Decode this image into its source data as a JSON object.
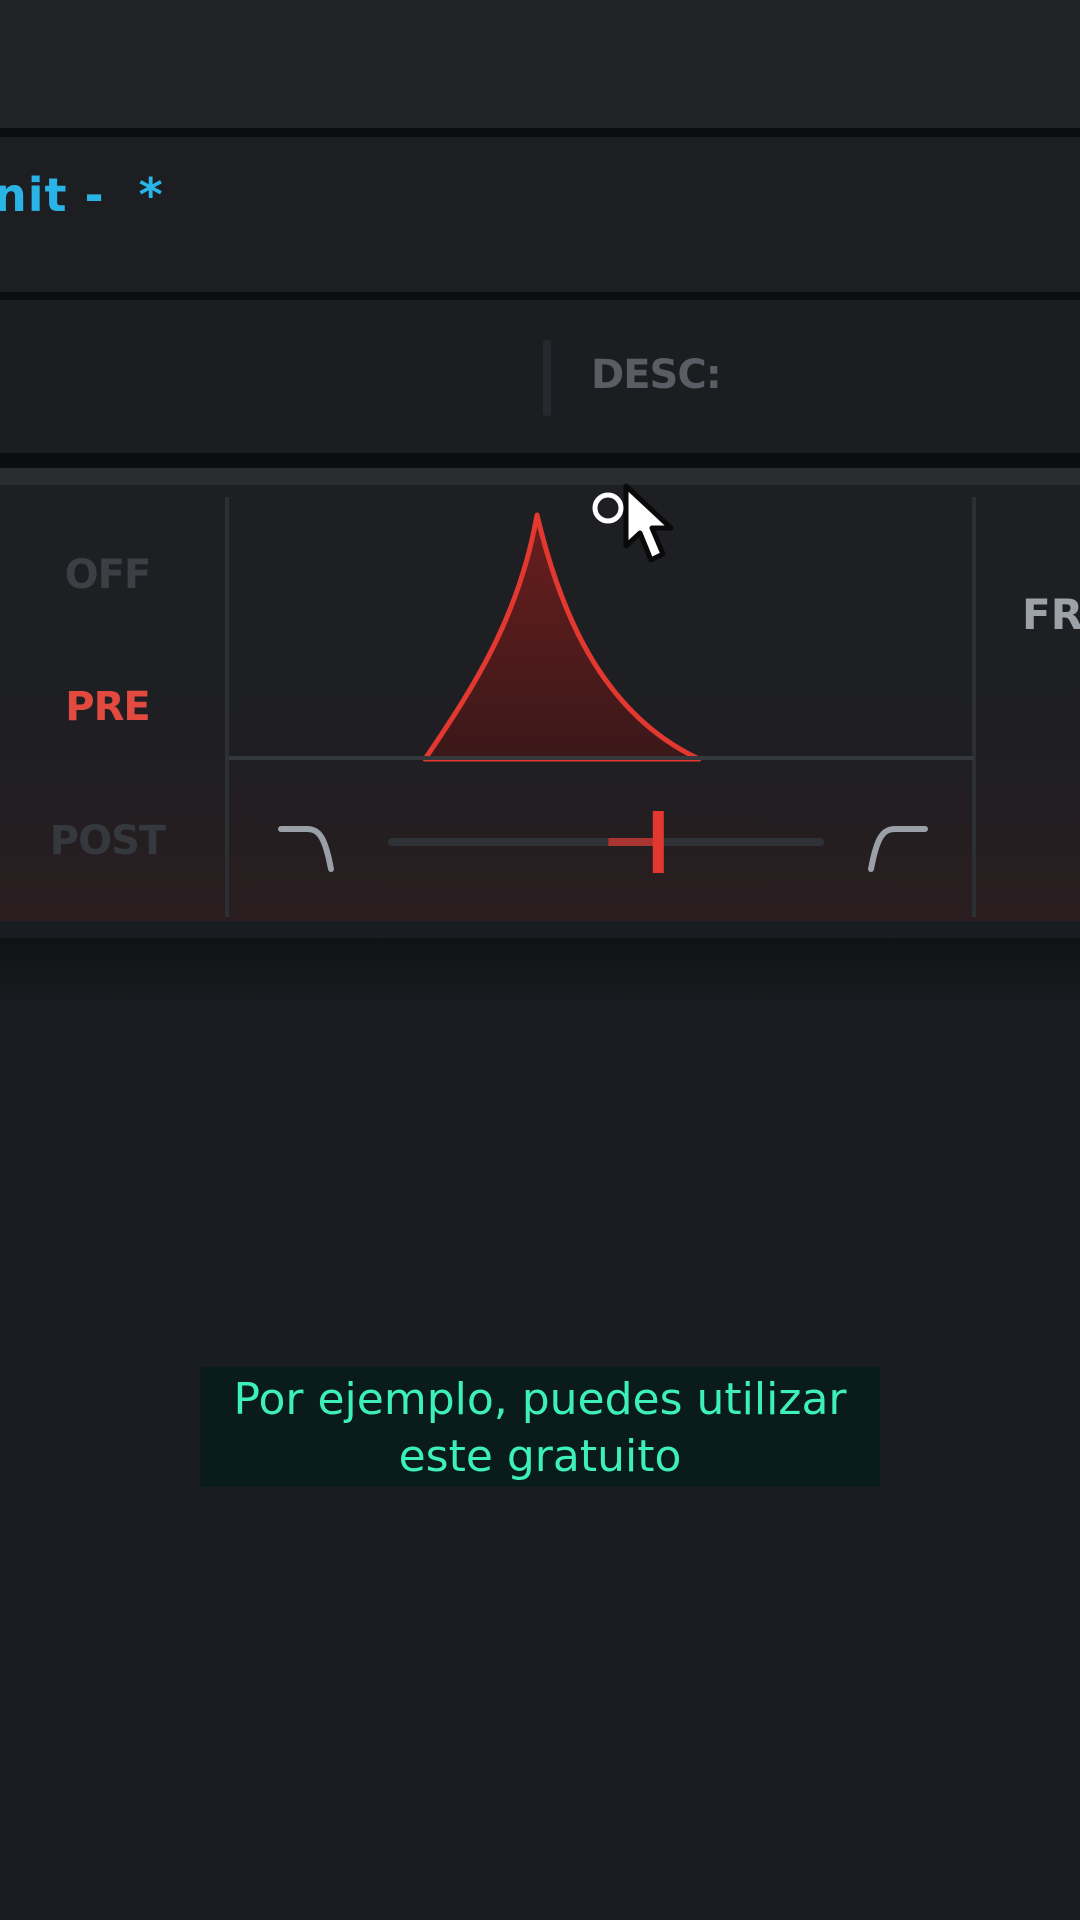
{
  "preset": {
    "name": "nit -  *"
  },
  "info": {
    "desc_label": "DESC:"
  },
  "modes": {
    "off": "OFF",
    "pre": "PRE",
    "post": "POST",
    "active": "PRE"
  },
  "filter": {
    "cutoff_position": 0.62,
    "left_icon": "low-shelf-icon",
    "right_icon": "high-shelf-icon"
  },
  "side_panel": {
    "label": "FR"
  },
  "subtitle": {
    "line1": "Por ejemplo, puedes utilizar",
    "line2": "este gratuito"
  },
  "colors": {
    "accent": "#e2493f",
    "preset_text": "#2ab4e6",
    "subtitle_text": "#3cf0b8",
    "background": "#191c20"
  }
}
